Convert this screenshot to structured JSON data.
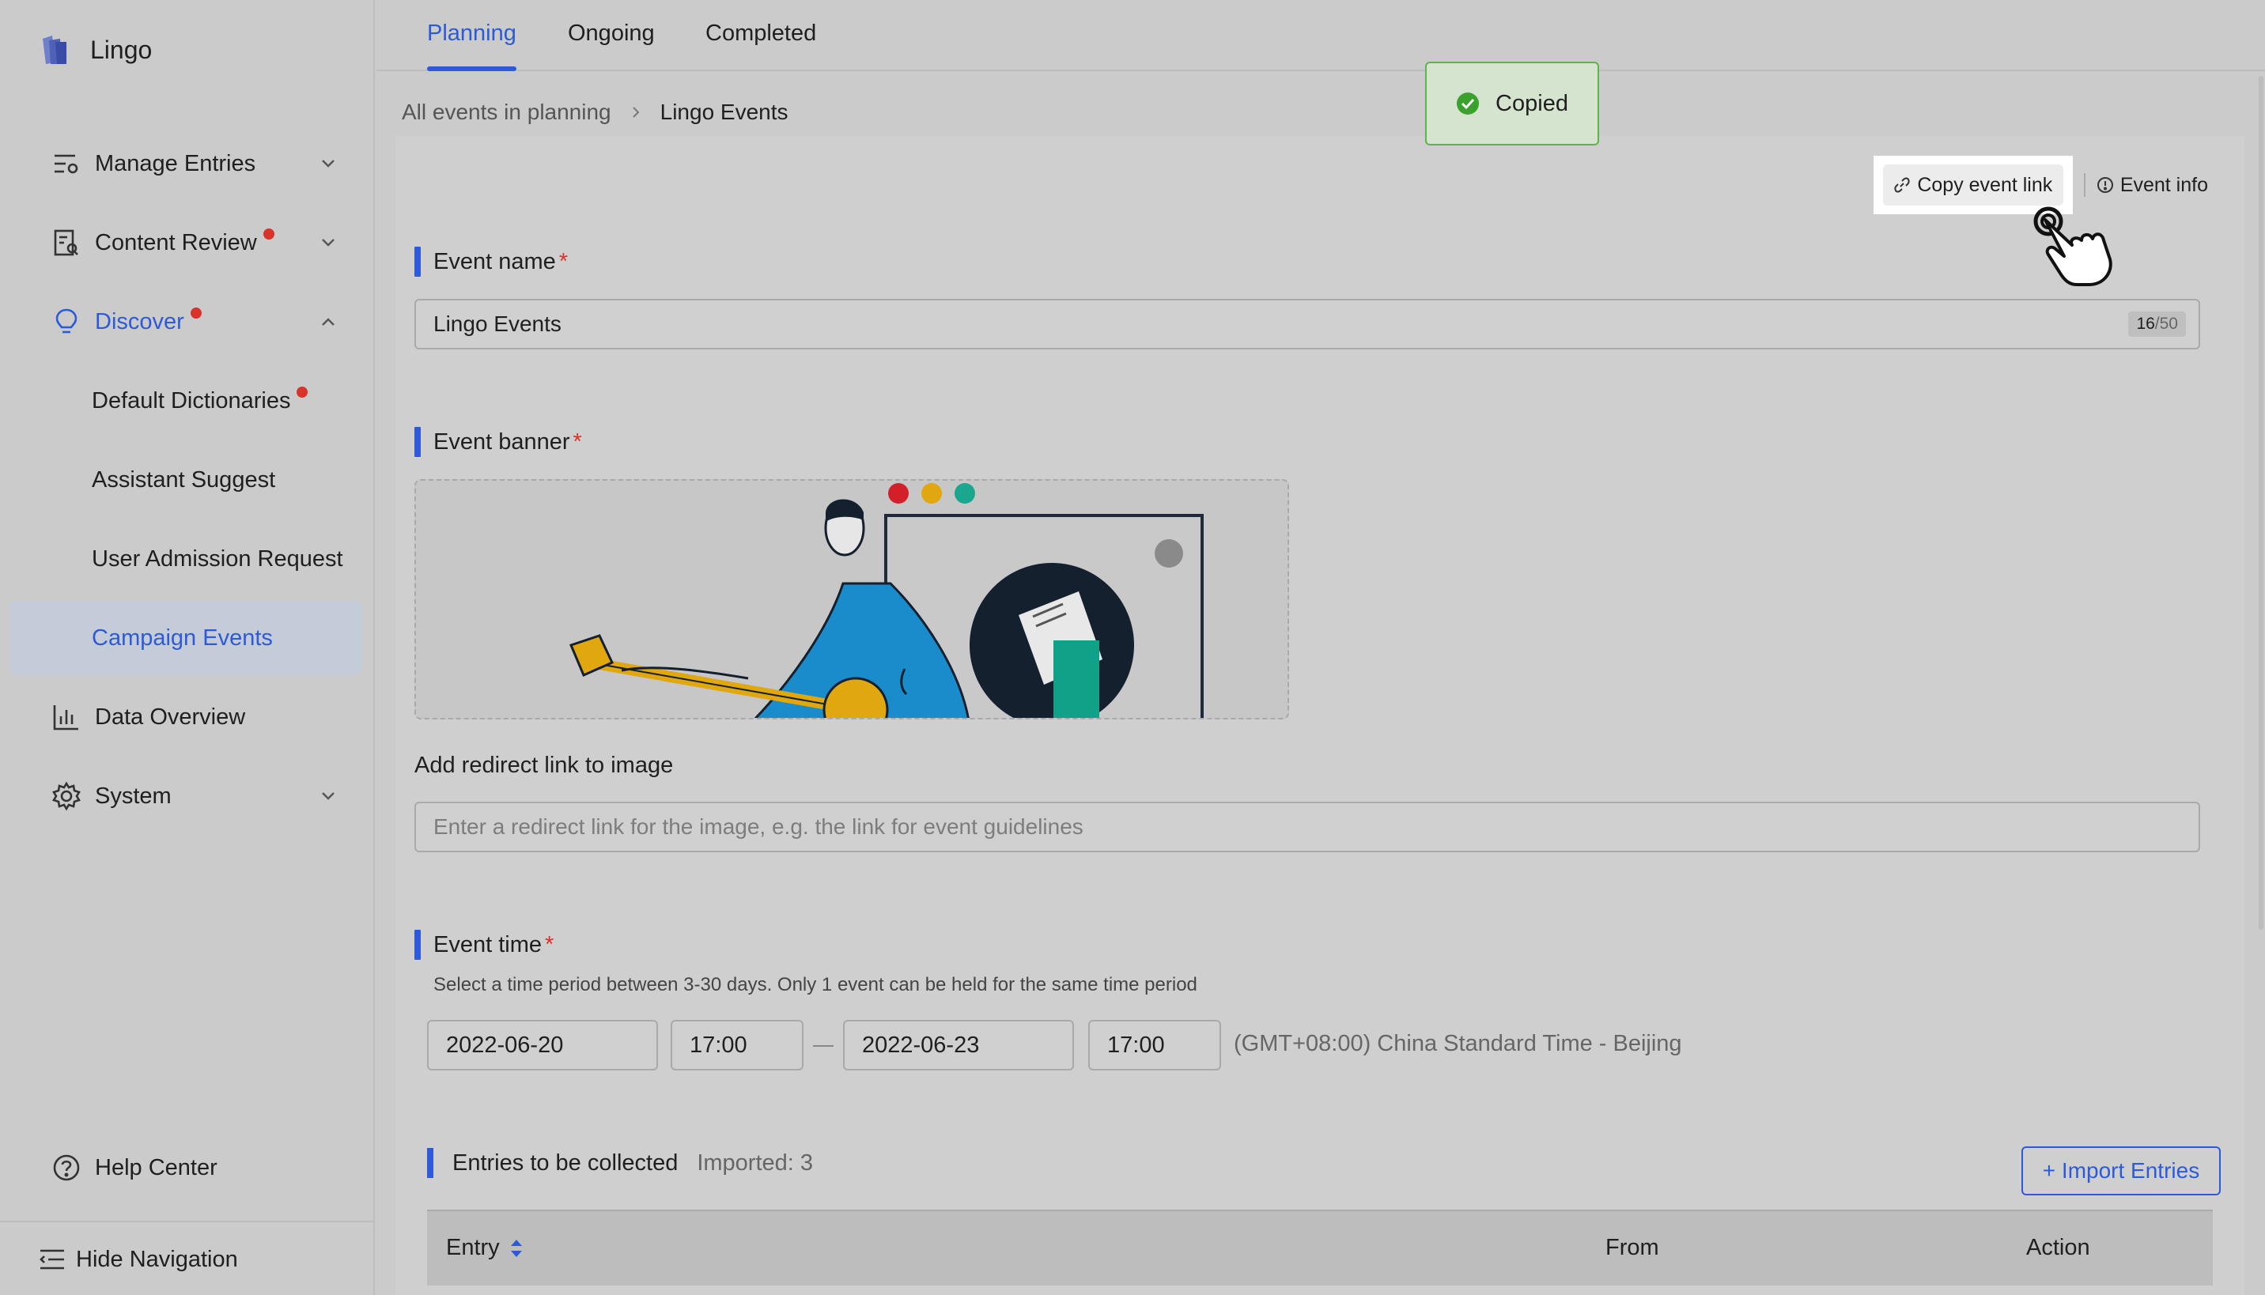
{
  "app": {
    "name": "Lingo"
  },
  "sidebar": {
    "items": [
      {
        "label": "Manage Entries",
        "icon": "list-settings-icon",
        "chevron": "down"
      },
      {
        "label": "Content Review",
        "icon": "document-review-icon",
        "badge": true,
        "chevron": "down"
      },
      {
        "label": "Discover",
        "icon": "lightbulb-icon",
        "badge": true,
        "chevron": "up",
        "expanded": true
      },
      {
        "label": "Default Dictionaries",
        "sub": true,
        "badge": true
      },
      {
        "label": "Assistant Suggest",
        "sub": true
      },
      {
        "label": "User Admission Request",
        "sub": true
      },
      {
        "label": "Campaign Events",
        "sub": true,
        "selected": true
      },
      {
        "label": "Data Overview",
        "icon": "bar-chart-icon"
      },
      {
        "label": "System",
        "icon": "gear-icon",
        "chevron": "down"
      }
    ],
    "help": "Help Center",
    "hide_nav": "Hide Navigation"
  },
  "tabs": [
    {
      "label": "Planning",
      "active": true
    },
    {
      "label": "Ongoing"
    },
    {
      "label": "Completed"
    }
  ],
  "breadcrumb": {
    "parent": "All events in planning",
    "current": "Lingo Events"
  },
  "toast": {
    "text": "Copied"
  },
  "actions": {
    "copy_link": "Copy event link",
    "event_info": "Event info"
  },
  "form": {
    "event_name": {
      "label": "Event name",
      "required": "*",
      "value": "Lingo Events",
      "count": "16",
      "max": "/50"
    },
    "event_banner": {
      "label": "Event banner",
      "required": "*"
    },
    "redirect": {
      "label": "Add redirect link to image",
      "placeholder": "Enter a redirect link for the image, e.g. the link for event guidelines"
    },
    "event_time": {
      "label": "Event time",
      "required": "*",
      "hint": "Select a time period between 3-30 days. Only 1 event can be held for the same time period",
      "start_date": "2022-06-20",
      "start_time": "17:00",
      "end_date": "2022-06-23",
      "end_time": "17:00",
      "timezone": "(GMT+08:00) China Standard Time - Beijing"
    },
    "entries": {
      "label": "Entries to be collected",
      "imported": "Imported: 3",
      "import_button": "+ Import Entries",
      "columns": [
        "Entry",
        "From",
        "Action"
      ]
    }
  },
  "colors": {
    "accent": "#2d5bd7",
    "danger": "#d9342b",
    "success": "#5fb34a"
  }
}
